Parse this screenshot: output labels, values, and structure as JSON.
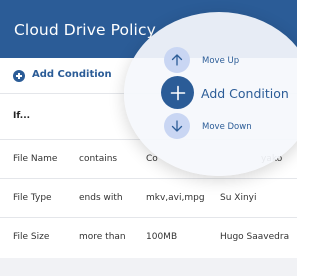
{
  "header": {
    "title": "Cloud Drive Policy"
  },
  "toolbar": {
    "add_condition_label": "Add Condition"
  },
  "rule": {
    "if_label": "If..."
  },
  "conditions": [
    {
      "field": "File Name",
      "operator": "contains",
      "value": "Co",
      "owner": "yako"
    },
    {
      "field": "File Type",
      "operator": "ends with",
      "value": "mkv,avi,mpg",
      "owner": "Su Xinyi"
    },
    {
      "field": "File Size",
      "operator": "more than",
      "value": "100MB",
      "owner": "Hugo Saavedra"
    }
  ],
  "radial_menu": {
    "move_up_label": "Move Up",
    "add_condition_label": "Add Condition",
    "move_down_label": "Move Down",
    "icons": {
      "move_up": "arrow-up-icon",
      "add": "plus-icon",
      "move_down": "arrow-down-icon"
    }
  },
  "colors": {
    "accent": "#2b5c97",
    "radial_secondary": "#c9d6f3"
  }
}
